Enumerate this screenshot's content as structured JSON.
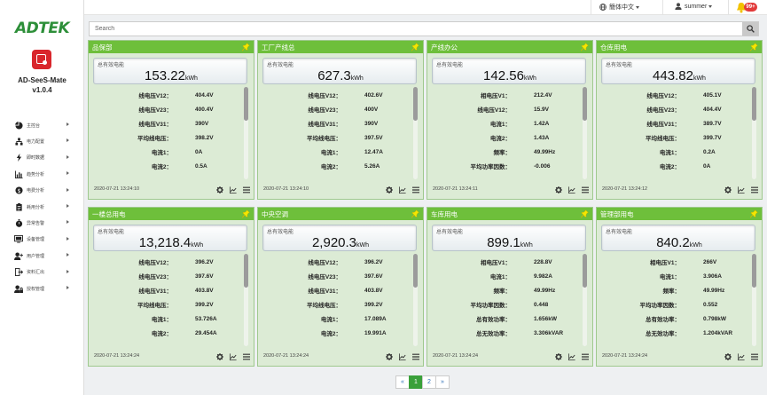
{
  "sidebar": {
    "logo": "ADTEK",
    "app_name": "AD-SeeS-Mate",
    "version": "v1.0.4",
    "items": [
      {
        "label": "主控台",
        "icon": "pie-chart-icon"
      },
      {
        "label": "电力配置",
        "icon": "sitemap-icon"
      },
      {
        "label": "即时数据",
        "icon": "bolt-icon"
      },
      {
        "label": "趋势分析",
        "icon": "bar-chart-icon"
      },
      {
        "label": "电费分析",
        "icon": "dollar-icon"
      },
      {
        "label": "耗用分析",
        "icon": "clipboard-icon"
      },
      {
        "label": "异常告警",
        "icon": "stopwatch-icon"
      },
      {
        "label": "设备管理",
        "icon": "monitor-icon"
      },
      {
        "label": "用户管理",
        "icon": "user-plus-icon"
      },
      {
        "label": "资料汇出",
        "icon": "export-icon"
      },
      {
        "label": "授权管理",
        "icon": "lock-user-icon"
      }
    ]
  },
  "topbar": {
    "language": "簡体中文",
    "user": "summer",
    "notification_count": "99+"
  },
  "search": {
    "placeholder": "Search"
  },
  "cards": [
    {
      "title": "品保部",
      "energy_label": "总有效电能",
      "energy_value": "153.22",
      "energy_unit": "kWh",
      "rows": [
        [
          "线电压V12：",
          "404.4V"
        ],
        [
          "线电压V23：",
          "400.4V"
        ],
        [
          "线电压V31：",
          "390V"
        ],
        [
          "平均线电压：",
          "398.2V"
        ],
        [
          "电流1：",
          "0A"
        ],
        [
          "电流2：",
          "0.5A"
        ]
      ],
      "timestamp": "2020-07-21 13:24:10"
    },
    {
      "title": "工厂产线总",
      "energy_label": "总有效电能",
      "energy_value": "627.3",
      "energy_unit": "kWh",
      "rows": [
        [
          "线电压V12：",
          "402.6V"
        ],
        [
          "线电压V23：",
          "400V"
        ],
        [
          "线电压V31：",
          "390V"
        ],
        [
          "平均线电压：",
          "397.5V"
        ],
        [
          "电流1：",
          "12.47A"
        ],
        [
          "电流2：",
          "5.26A"
        ]
      ],
      "timestamp": "2020-07-21 13:24:10"
    },
    {
      "title": "产线办公",
      "energy_label": "总有效电能",
      "energy_value": "142.56",
      "energy_unit": "kWh",
      "rows": [
        [
          "相电压V1：",
          "212.4V"
        ],
        [
          "线电压V12：",
          "15.9V"
        ],
        [
          "电流1：",
          "1.42A"
        ],
        [
          "电流2：",
          "1.43A"
        ],
        [
          "频率：",
          "49.99Hz"
        ],
        [
          "平均功率因数：",
          "-0.006"
        ]
      ],
      "timestamp": "2020-07-21 13:24:11"
    },
    {
      "title": "仓库用电",
      "energy_label": "总有效电能",
      "energy_value": "443.82",
      "energy_unit": "kWh",
      "rows": [
        [
          "线电压V12：",
          "405.1V"
        ],
        [
          "线电压V23：",
          "404.4V"
        ],
        [
          "线电压V31：",
          "389.7V"
        ],
        [
          "平均线电压：",
          "399.7V"
        ],
        [
          "电流1：",
          "0.2A"
        ],
        [
          "电流2：",
          "0A"
        ]
      ],
      "timestamp": "2020-07-21 13:24:12"
    },
    {
      "title": "一楼总用电",
      "energy_label": "总有效电能",
      "energy_value": "13,218.4",
      "energy_unit": "kWh",
      "rows": [
        [
          "线电压V12：",
          "396.2V"
        ],
        [
          "线电压V23：",
          "397.6V"
        ],
        [
          "线电压V31：",
          "403.8V"
        ],
        [
          "平均线电压：",
          "399.2V"
        ],
        [
          "电流1：",
          "53.726A"
        ],
        [
          "电流2：",
          "29.454A"
        ]
      ],
      "timestamp": "2020-07-21 13:24:24"
    },
    {
      "title": "中央空调",
      "energy_label": "总有效电能",
      "energy_value": "2,920.3",
      "energy_unit": "kWh",
      "rows": [
        [
          "线电压V12：",
          "396.2V"
        ],
        [
          "线电压V23：",
          "397.6V"
        ],
        [
          "线电压V31：",
          "403.8V"
        ],
        [
          "平均线电压：",
          "399.2V"
        ],
        [
          "电流1：",
          "17.089A"
        ],
        [
          "电流2：",
          "19.991A"
        ]
      ],
      "timestamp": "2020-07-21 13:24:24"
    },
    {
      "title": "车库用电",
      "energy_label": "总有效电能",
      "energy_value": "899.1",
      "energy_unit": "kWh",
      "rows": [
        [
          "相电压V1：",
          "228.8V"
        ],
        [
          "电流1：",
          "9.982A"
        ],
        [
          "频率：",
          "49.99Hz"
        ],
        [
          "平均功率因数：",
          "0.448"
        ],
        [
          "总有效功率：",
          "1.656kW"
        ],
        [
          "总无效功率：",
          "3.306kVAR"
        ]
      ],
      "timestamp": "2020-07-21 13:24:24"
    },
    {
      "title": "管理部用电",
      "energy_label": "总有效电能",
      "energy_value": "840.2",
      "energy_unit": "kWh",
      "rows": [
        [
          "相电压V1：",
          "266V"
        ],
        [
          "电流1：",
          "3.906A"
        ],
        [
          "频率：",
          "49.99Hz"
        ],
        [
          "平均功率因数：",
          "0.552"
        ],
        [
          "总有效功率：",
          "0.798kW"
        ],
        [
          "总无效功率：",
          "1.204kVAR"
        ]
      ],
      "timestamp": "2020-07-21 13:24:24"
    }
  ],
  "pagination": {
    "prev": "«",
    "pages": [
      "1",
      "2"
    ],
    "next": "»",
    "current": "1"
  },
  "colors": {
    "header_green": "#6ebf3b",
    "card_bg": "#dcebd5",
    "logo_green": "#2d8f39",
    "badge_red": "#e23a3a"
  }
}
